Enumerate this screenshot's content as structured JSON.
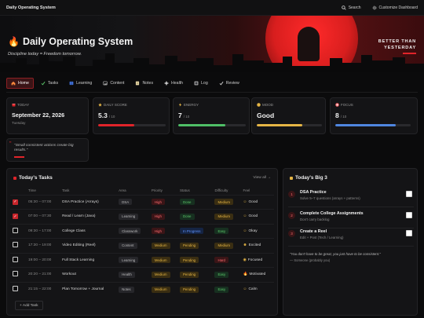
{
  "topbar": {
    "title": "Daily Operating System",
    "search_label": "Search",
    "customize_label": "Customize Dashboard"
  },
  "hero": {
    "title": "Daily Operating System",
    "tagline": "Discipline today = Freedom tomorrow.",
    "side_line1": "BETTER THAN",
    "side_line2": "YESTERDAY"
  },
  "nav": {
    "tabs": [
      {
        "label": "Home",
        "icon": "home-icon"
      },
      {
        "label": "Tasks",
        "icon": "check-icon"
      },
      {
        "label": "Learning",
        "icon": "book-icon"
      },
      {
        "label": "Content",
        "icon": "image-icon"
      },
      {
        "label": "Notes",
        "icon": "note-icon"
      },
      {
        "label": "Health",
        "icon": "plus-icon"
      },
      {
        "label": "Log",
        "icon": "log-icon"
      },
      {
        "label": "Review",
        "icon": "check-icon"
      }
    ]
  },
  "stats": [
    {
      "label": "TODAY",
      "value": "September 22, 2026",
      "sub": "Tuesday",
      "color": "#e0242a",
      "icon": "calendar-icon"
    },
    {
      "label": "DAILY SCORE",
      "value": "5.3",
      "unit": "/ 10",
      "progress": 0.53,
      "color": "#e0242a",
      "icon": "star-icon"
    },
    {
      "label": "ENERGY",
      "value": "7",
      "unit": "/ 10",
      "progress": 0.7,
      "color": "#4fbf67",
      "icon": "bolt-icon"
    },
    {
      "label": "MOOD",
      "value": "Good",
      "progress": 0.7,
      "color": "#e5b545",
      "icon": "mood-icon"
    },
    {
      "label": "FOCUS",
      "value": "8",
      "unit": "/ 10",
      "progress": 0.8,
      "color": "#4f86e0",
      "icon": "target-icon"
    }
  ],
  "quote_card": {
    "text": "Small consistent actions create big results."
  },
  "tasks": {
    "title": "Today's Tasks",
    "view_all": "View all →",
    "columns": [
      "Time",
      "Task",
      "Area",
      "Priority",
      "Status",
      "Difficulty",
      "Feel"
    ],
    "rows": [
      {
        "checked": true,
        "time": "05:30 – 07:00",
        "task": "DSA Practice (Arrays)",
        "area": "DSA",
        "priority": "High",
        "status": "Done",
        "difficulty": "Medium",
        "feel": "Good",
        "feel_icon": "☺"
      },
      {
        "checked": true,
        "time": "07:00 – 07:30",
        "task": "Read / Learn (Java)",
        "area": "Learning",
        "priority": "High",
        "status": "Done",
        "difficulty": "Medium",
        "feel": "Good",
        "feel_icon": "☺"
      },
      {
        "checked": false,
        "time": "09:30 – 17:00",
        "task": "College Class",
        "area": "Classwork",
        "priority": "High",
        "status": "In Progress",
        "difficulty": "Easy",
        "feel": "Okay",
        "feel_icon": "☺"
      },
      {
        "checked": false,
        "time": "17:30 – 19:00",
        "task": "Video Editing (Reel)",
        "area": "Content",
        "priority": "Medium",
        "status": "Pending",
        "difficulty": "Medium",
        "feel": "Excited",
        "feel_icon": "☻"
      },
      {
        "checked": false,
        "time": "19:00 – 20:00",
        "task": "Full Stack Learning",
        "area": "Learning",
        "priority": "Medium",
        "status": "Pending",
        "difficulty": "Hard",
        "feel": "Focused",
        "feel_icon": "◉"
      },
      {
        "checked": false,
        "time": "20:20 – 21:00",
        "task": "Workout",
        "area": "Health",
        "priority": "Medium",
        "status": "Pending",
        "difficulty": "Easy",
        "feel": "Motivated",
        "feel_icon": "🔥"
      },
      {
        "checked": false,
        "time": "21:15 – 22:00",
        "task": "Plan Tomorrow + Journal",
        "area": "Notes",
        "priority": "Medium",
        "status": "Pending",
        "difficulty": "Easy",
        "feel": "Calm",
        "feel_icon": "☺"
      }
    ],
    "add_label": "+ Add Task"
  },
  "big3": {
    "title": "Today's Big 3",
    "items": [
      {
        "num": "1",
        "title": "DSA Practice",
        "sub": "Solve 5–7 questions (arrays + patterns)"
      },
      {
        "num": "2",
        "title": "Complete College Assignments",
        "sub": "Don't carry backlog"
      },
      {
        "num": "3",
        "title": "Create a Reel",
        "sub": "Edit + Post (Tech / Learning)"
      }
    ],
    "quote": "\"You don't have to be great, you just have to be consistent.\"",
    "author": "— Someone (probably you)"
  }
}
